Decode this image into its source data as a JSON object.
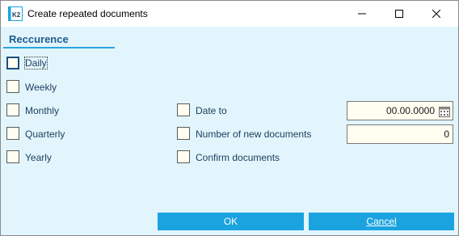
{
  "window": {
    "title": "Create repeated documents"
  },
  "section": {
    "title": "Reccurence"
  },
  "recurrence_options": [
    {
      "label": "Daily",
      "checked": false
    },
    {
      "label": "Weekly",
      "checked": false
    },
    {
      "label": "Monthly",
      "checked": false
    },
    {
      "label": "Quarterly",
      "checked": false
    },
    {
      "label": "Yearly",
      "checked": false
    }
  ],
  "right_options": [
    {
      "label": "Date to",
      "checked": false
    },
    {
      "label": "Number of new documents",
      "checked": false
    },
    {
      "label": "Confirm documents",
      "checked": false
    }
  ],
  "fields": {
    "date_to_value": "00.00.0000",
    "number_of_documents_value": "0"
  },
  "buttons": {
    "ok_label": "OK",
    "cancel_label": "Cancel"
  },
  "icons": {
    "app": "k2-app-icon",
    "minimize": "minimize-icon",
    "maximize": "maximize-icon",
    "close": "close-icon",
    "calendar": "calendar-icon"
  },
  "colors": {
    "background": "#e2f5fd",
    "accent": "#1ba3e0",
    "field_bg": "#fffef0",
    "text": "#1a3d5c"
  }
}
